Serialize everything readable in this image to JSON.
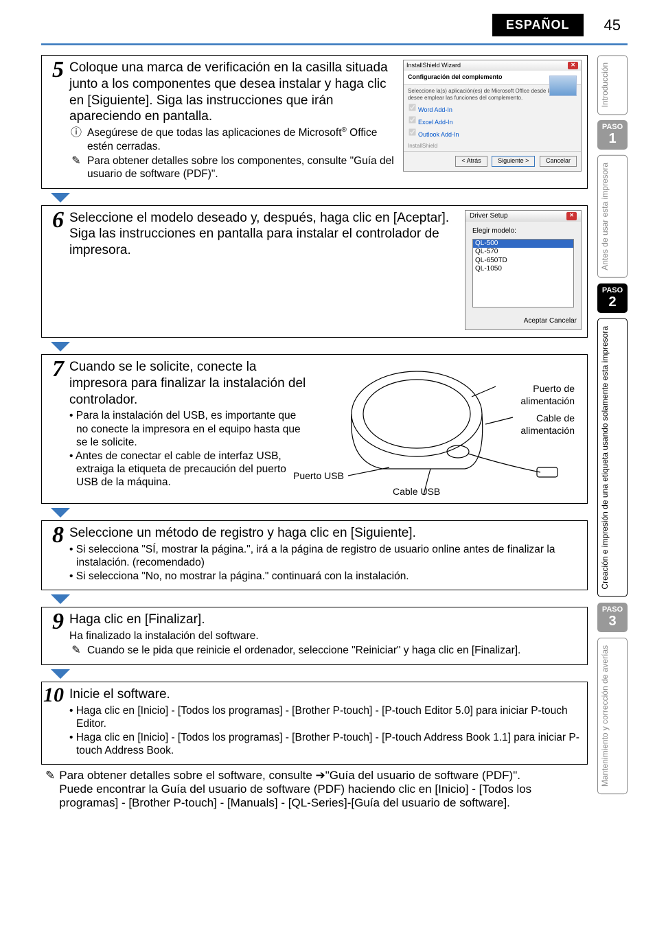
{
  "header": {
    "language": "ESPAÑOL",
    "page_number": "45"
  },
  "steps": {
    "s5": {
      "num": "5",
      "lead": "Coloque una marca de verificación en la casilla situada junto a los componentes que desea instalar y haga clic en [Siguiente]. Siga las instrucciones que irán apareciendo en pantalla.",
      "note1_icon": "ⓘ",
      "note1": "Asegúrese de que todas las aplicaciones de Microsoft",
      "note1_sup": "®",
      "note1_tail": " Office estén cerradas.",
      "note2_icon": "✎",
      "note2": "Para obtener detalles sobre los componentes, consulte \"Guía del usuario de software (PDF)\".",
      "wiz": {
        "title": "InstallShield Wizard",
        "subtitle": "Configuración del complemento",
        "desc": "Seleccione la(s) aplicación(es) de Microsoft Office desde las que desee emplear las funciones del complemento.",
        "chk1": "Word Add-In",
        "chk2": "Excel Add-In",
        "chk3": "Outlook Add-In",
        "brand": "InstallShield",
        "back": "< Atrás",
        "next": "Siguiente >",
        "cancel": "Cancelar"
      }
    },
    "s6": {
      "num": "6",
      "lead": "Seleccione el modelo deseado y, después, haga clic en [Aceptar]. Siga las instrucciones en pantalla para instalar el controlador de impresora.",
      "dlg": {
        "title": "Driver Setup",
        "label": "Elegir modelo:",
        "items": [
          "QL-500",
          "QL-570",
          "QL-650TD",
          "QL-1050"
        ],
        "ok": "Aceptar",
        "cancel": "Cancelar"
      }
    },
    "s7": {
      "num": "7",
      "lead": "Cuando se le solicite, conecte la impresora para finalizar la instalación del controlador.",
      "b1": "• Para la instalación del USB, es importante que no conecte la impresora en el equipo hasta que se le solicite.",
      "b2": "• Antes de conectar el cable de interfaz USB, extraiga la etiqueta de precaución del puerto USB de la máquina.",
      "labels": {
        "power_port": "Puerto de alimentación",
        "power_cable": "Cable de alimentación",
        "usb_port": "Puerto USB",
        "usb_cable": "Cable USB"
      }
    },
    "s8": {
      "num": "8",
      "lead": "Seleccione un método de registro y haga clic en [Siguiente].",
      "b1": "• Si selecciona \"SÍ, mostrar la página.\", irá a la página de registro de usuario online antes de finalizar la instalación. (recomendado)",
      "b2": "• Si selecciona \"No, no mostrar la página.\" continuará con la instalación."
    },
    "s9": {
      "num": "9",
      "lead": "Haga clic en [Finalizar].",
      "sub": "Ha finalizado la instalación del software.",
      "note_icon": "✎",
      "note": "Cuando se le pida que reinicie el ordenador, seleccione \"Reiniciar\" y haga clic en [Finalizar]."
    },
    "s10": {
      "num": "10",
      "lead": "Inicie el software.",
      "b1": "• Haga clic en [Inicio] - [Todos los programas] - [Brother P-touch] - [P-touch Editor 5.0] para iniciar P-touch Editor.",
      "b2": "• Haga clic en [Inicio] - [Todos los programas] - [Brother P-touch] - [P-touch Address Book 1.1] para iniciar P-touch Address Book."
    }
  },
  "footer_note": {
    "icon": "✎",
    "l1": "Para obtener detalles sobre el software, consulte ➔\"Guía del usuario de software (PDF)\".",
    "l2": "Puede encontrar la Guía del usuario de software (PDF) haciendo clic en [Inicio] - [Todos los programas] - [Brother P-touch] - [Manuals] - [QL-Series]-[Guía del usuario de software]."
  },
  "tabs": {
    "t0": "Introducción",
    "paso": "PASO",
    "n1": "1",
    "t1": "Antes de usar esta impresora",
    "n2": "2",
    "t2": "Creación e impresión de una etiqueta usando solamente esta impresora",
    "n3": "3",
    "t3": "Mantenimiento y corrección de averías"
  }
}
